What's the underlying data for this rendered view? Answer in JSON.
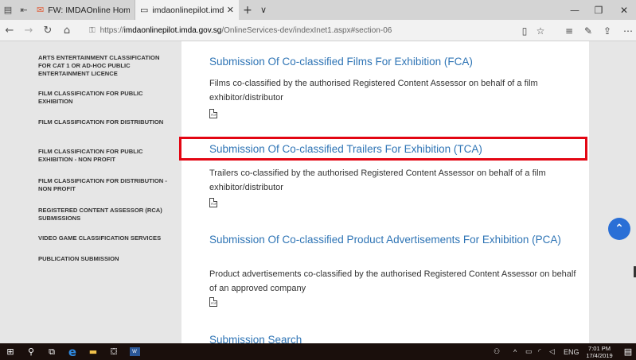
{
  "browser": {
    "tabs": [
      {
        "label": "FW: IMDAOnline Home Pag",
        "icon": "mail-icon",
        "active": false
      },
      {
        "label": "imdaonlinepilot.imda.g",
        "icon": "page-icon",
        "active": true
      }
    ],
    "new_tab_symbol": "+",
    "tab_menu_symbol": "∨",
    "url_prefix": "https://",
    "url_host": "imdaonlinepilot.imda.gov.sg",
    "url_path": "/OnlineServices-dev/indexInet1.aspx#section-06"
  },
  "sidebar": {
    "items": [
      {
        "label": "ARTS ENTERTAINMENT CLASSIFICATION FOR CAT 1 OR AD-HOC PUBLIC ENTERTAINMENT LICENCE"
      },
      {
        "label": "FILM CLASSIFICATION FOR PUBLIC EXHIBITION"
      },
      {
        "label": "FILM CLASSIFICATION FOR DISTRIBUTION"
      },
      {
        "label": "FILM CLASSIFICATION FOR PUBLIC EXHIBITION - NON PROFIT"
      },
      {
        "label": "FILM CLASSIFICATION FOR DISTRIBUTION - NON PROFIT"
      },
      {
        "label": "REGISTERED CONTENT ASSESSOR (RCA) SUBMISSIONS"
      },
      {
        "label": "VIDEO GAME CLASSIFICATION SERVICES"
      },
      {
        "label": "PUBLICATION SUBMISSION"
      }
    ]
  },
  "main": {
    "sections": [
      {
        "title": "Submission Of Co-classified Films For Exhibition (FCA)",
        "description": "Films co-classified by the authorised Registered Content Assessor on behalf of a film exhibitor/distributor",
        "pdf_label": "PDF"
      },
      {
        "title": "Submission Of Co-classified Trailers For Exhibition (TCA)",
        "description": "Trailers co-classified by the authorised Registered Content Assessor on behalf of a film exhibitor/distributor",
        "pdf_label": "PDF"
      },
      {
        "title": "Submission Of Co-classified Product Advertisements For Exhibition (PCA)",
        "description": "Product advertisements co-classified by the authorised Registered Content Assessor on behalf of an approved company",
        "pdf_label": "PDF"
      },
      {
        "title": "Submission Search"
      }
    ],
    "highlight_color": "#e30613",
    "link_color": "#2e74b5"
  },
  "taskbar": {
    "language": "ENG",
    "time": "7:01 PM",
    "date": "17/4/2019",
    "word_label": "W"
  }
}
